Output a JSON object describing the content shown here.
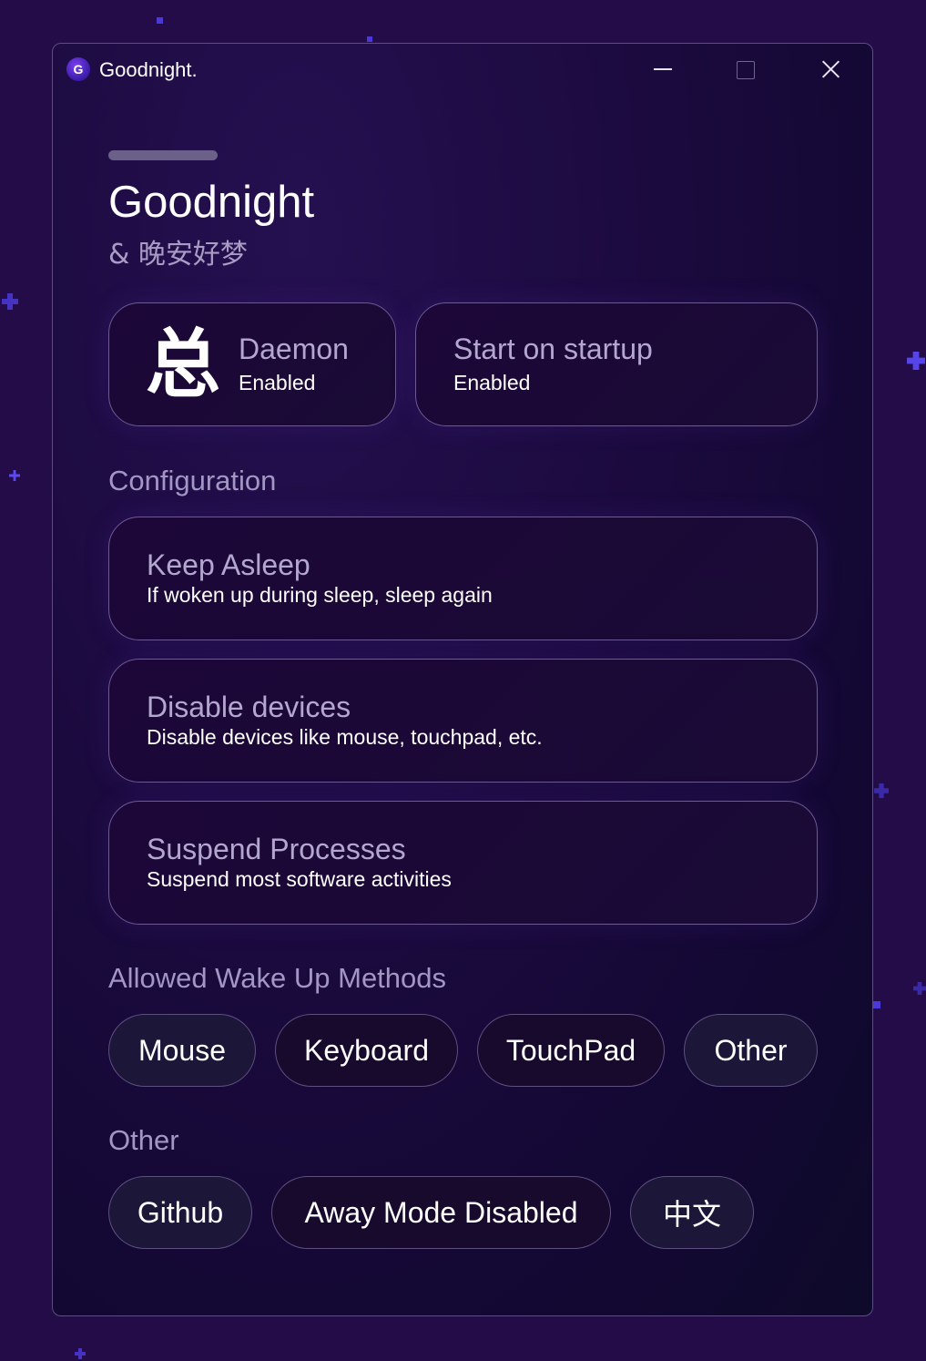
{
  "window": {
    "app_title": "Goodnight.",
    "app_icon_letter": "G",
    "heading": "Goodnight",
    "subheading": "& 晚安好梦"
  },
  "status_cards": {
    "daemon": {
      "glyph": "总",
      "title": "Daemon",
      "status": "Enabled"
    },
    "startup": {
      "title": "Start on startup",
      "status": "Enabled"
    }
  },
  "configuration": {
    "label": "Configuration",
    "items": [
      {
        "title": "Keep Asleep",
        "description": "If woken up during sleep, sleep again"
      },
      {
        "title": "Disable devices",
        "description": "Disable devices like mouse, touchpad, etc."
      },
      {
        "title": "Suspend Processes",
        "description": "Suspend most software activities"
      }
    ]
  },
  "wake_methods": {
    "label": "Allowed Wake Up Methods",
    "options": [
      "Mouse",
      "Keyboard",
      "TouchPad",
      "Other"
    ]
  },
  "other": {
    "label": "Other",
    "buttons": [
      "Github",
      "Away Mode Disabled",
      "中文"
    ]
  },
  "colors": {
    "background": "#230c47",
    "card_border": "#6c5a92",
    "muted_text": "#a297c4",
    "star": "#4a38d8"
  }
}
